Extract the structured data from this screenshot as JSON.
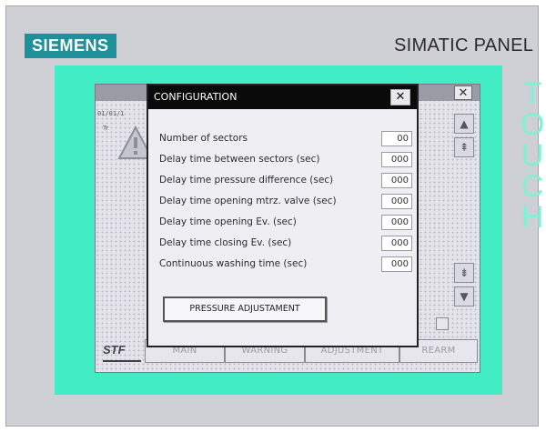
{
  "device": {
    "brand": "SIEMENS",
    "model": "SIMATIC PANEL",
    "touch_label": "TOUCH"
  },
  "colors": {
    "bezel": "#42ecc4",
    "brand": "#1f8f99",
    "title_bar": "#0a0a0a"
  },
  "background_screen": {
    "close_glyph": "✕",
    "date_text": "01/01/1",
    "row_text": "Tr",
    "warning_icon": "warning-triangle-icon"
  },
  "dialog": {
    "title": "CONFIGURATION",
    "close_glyph": "✕",
    "rows": [
      {
        "label": "Number of sectors",
        "value": "00"
      },
      {
        "label": "Delay time between sectors (sec)",
        "value": "000"
      },
      {
        "label": "Delay time pressure difference (sec)",
        "value": "000"
      },
      {
        "label": "Delay time opening mtrz. valve (sec)",
        "value": "000"
      },
      {
        "label": "Delay time opening Ev. (sec)",
        "value": "000"
      },
      {
        "label": "Delay time closing Ev. (sec)",
        "value": "000"
      },
      {
        "label": "Continuous washing time (sec)",
        "value": "000"
      }
    ],
    "button_label": "PRESSURE ADJUSTAMENT"
  },
  "scroll": {
    "up": "▲",
    "page_up": "⇞",
    "page_down": "⇟",
    "down": "▼"
  },
  "tabs": {
    "logo": "STF",
    "items": [
      "MAIN",
      "WARNING",
      "ADJUSTMENT",
      "REARM"
    ]
  }
}
